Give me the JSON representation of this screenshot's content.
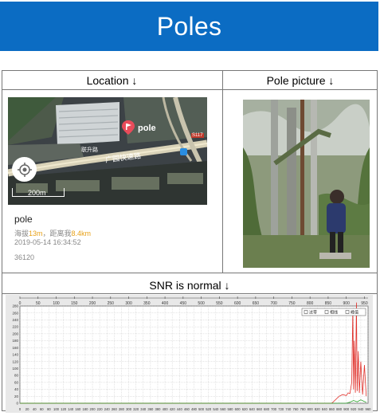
{
  "slide_title": "Poles",
  "headers": {
    "location": "Location ↓",
    "pole_picture": "Pole picture ↓",
    "snr": "SNR is normal ↓"
  },
  "map": {
    "marker_label": "pole",
    "road_label": "广园快速路",
    "road_label_small": "联升路",
    "road_badge": "S117",
    "scale": "200m"
  },
  "location_info": {
    "name": "pole",
    "altitude_prefix": "海拔",
    "altitude_value": "13m",
    "distance_prefix": "，距离我",
    "distance_value": "8.4km",
    "timestamp": "2019-05-14 16:34:52",
    "code": "36120"
  },
  "chart_data": {
    "type": "line",
    "x_top_ticks": [
      "0",
      "50",
      "100",
      "150",
      "200",
      "250",
      "300",
      "350",
      "400",
      "450",
      "500",
      "550",
      "600",
      "650",
      "700",
      "750",
      "800",
      "850",
      "900",
      "950"
    ],
    "x_bottom_ticks": [
      "0",
      "20",
      "40",
      "60",
      "80",
      "100",
      "120",
      "140",
      "160",
      "180",
      "200",
      "220",
      "240",
      "260",
      "280",
      "300",
      "320",
      "340",
      "360",
      "380",
      "400",
      "420",
      "440",
      "460",
      "480",
      "500",
      "520",
      "540",
      "560",
      "580",
      "600",
      "620",
      "640",
      "660",
      "680",
      "700",
      "720",
      "740",
      "760",
      "780",
      "800",
      "820",
      "840",
      "860",
      "880",
      "900",
      "920",
      "940",
      "960"
    ],
    "y_ticks": [
      "280",
      "260",
      "240",
      "220",
      "200",
      "180",
      "160",
      "140",
      "120",
      "100",
      "80",
      "60",
      "40",
      "20",
      "0"
    ],
    "xlim": [
      0,
      960
    ],
    "ylim": [
      0,
      280
    ],
    "legend": [
      "过零",
      "相线",
      "峰值"
    ],
    "series": [
      {
        "color": "#e0302a",
        "x": [
          0,
          860,
          880,
          890,
          900,
          905,
          910,
          915,
          918,
          920,
          922,
          925,
          928,
          930,
          933,
          936,
          940,
          945,
          950,
          955
        ],
        "y": [
          0,
          0,
          20,
          25,
          22,
          30,
          28,
          60,
          270,
          40,
          180,
          30,
          290,
          35,
          150,
          30,
          120,
          25,
          110,
          20
        ]
      },
      {
        "color": "#2aa12a",
        "x": [
          0,
          900,
          910,
          920,
          930,
          940,
          950,
          955
        ],
        "y": [
          0,
          0,
          3,
          8,
          4,
          10,
          5,
          3
        ]
      }
    ],
    "colors": {
      "red": "#e0302a",
      "green": "#2aa12a"
    }
  },
  "colors": {
    "banner": "#0b6cc3",
    "altitude_accent": "#e8a21a",
    "marker": "#e94b5a"
  }
}
